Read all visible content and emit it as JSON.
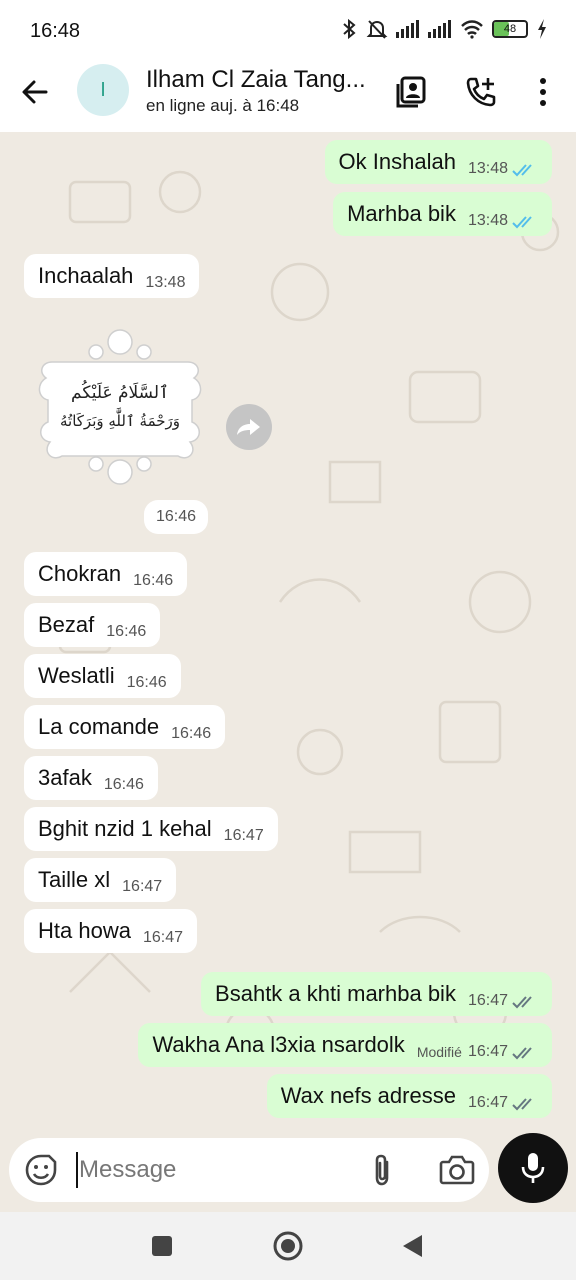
{
  "status_bar": {
    "time": "16:48",
    "battery_level": "48",
    "icons": [
      "bluetooth-icon",
      "notifications-off-icon",
      "signal-icon",
      "signal-icon",
      "wifi-icon",
      "battery-icon",
      "charging-icon"
    ]
  },
  "header": {
    "avatar_initial": "I",
    "contact_name": "Ilham Cl Zaia Tang...",
    "status": "en ligne auj. à 16:48",
    "icons": [
      "back-arrow-icon",
      "contact-card-icon",
      "add-call-icon",
      "more-vert-icon"
    ]
  },
  "messages": [
    {
      "direction": "out",
      "text": "Ok Inshalah",
      "time": "13:48",
      "status": "read"
    },
    {
      "direction": "out",
      "text": "Marhba bik",
      "time": "13:48",
      "status": "read"
    },
    {
      "direction": "in",
      "text": "Inchaalah",
      "time": "13:48"
    },
    {
      "direction": "in",
      "type": "sticker",
      "sticker_text_line1": "ٱلسَّلَامُ عَلَيْكُم",
      "sticker_text_line2": "وَرَحْمَةُ ٱللَّٰهِ وَبَرَكَاتُهُ",
      "time": "16:46"
    },
    {
      "direction": "in",
      "text": "Chokran",
      "time": "16:46"
    },
    {
      "direction": "in",
      "text": "Bezaf",
      "time": "16:46"
    },
    {
      "direction": "in",
      "text": "Weslatli",
      "time": "16:46"
    },
    {
      "direction": "in",
      "text": "La comande",
      "time": "16:46"
    },
    {
      "direction": "in",
      "text": "3afak",
      "time": "16:46"
    },
    {
      "direction": "in",
      "text": "Bghit nzid 1 kehal",
      "time": "16:47"
    },
    {
      "direction": "in",
      "text": "Taille xl",
      "time": "16:47"
    },
    {
      "direction": "in",
      "text": "Hta howa",
      "time": "16:47"
    },
    {
      "direction": "out",
      "text": "Bsahtk a khti marhba bik",
      "time": "16:47",
      "status": "delivered"
    },
    {
      "direction": "out",
      "text": "Wakha Ana l3xia nsardolk",
      "edited_label": "Modifié",
      "time": "16:47",
      "status": "delivered"
    },
    {
      "direction": "out",
      "text": "Wax nefs adresse",
      "time": "16:47",
      "status": "delivered"
    }
  ],
  "composer": {
    "placeholder": "Message",
    "icons": [
      "emoji-icon",
      "attach-icon",
      "camera-icon",
      "mic-icon"
    ]
  },
  "colors": {
    "chat_background": "#efeae2",
    "outgoing_bubble": "#d9fdd3",
    "incoming_bubble": "#ffffff",
    "read_ticks": "#53bdeb",
    "mic_button": "#111111",
    "avatar_bg": "#d6eef0"
  },
  "nav_bar": {
    "icons": [
      "recents-square-icon",
      "home-circle-icon",
      "back-triangle-icon"
    ]
  }
}
